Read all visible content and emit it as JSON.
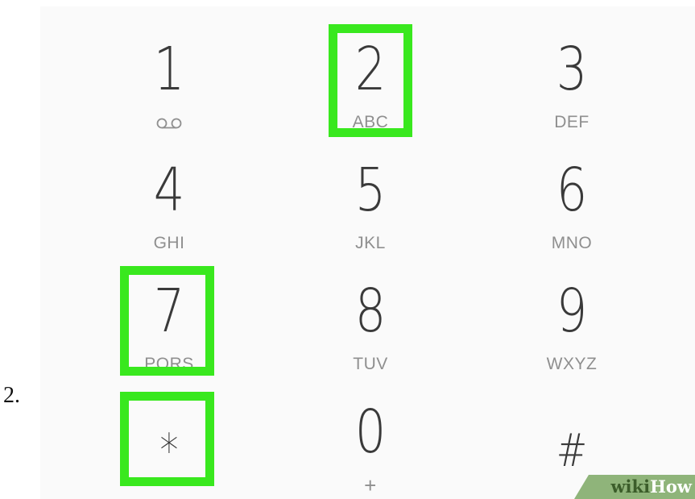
{
  "step_label": "2.",
  "keypad": {
    "keys": [
      {
        "digit": "1",
        "letters": "",
        "icon": "voicemail-icon"
      },
      {
        "digit": "2",
        "letters": "ABC"
      },
      {
        "digit": "3",
        "letters": "DEF"
      },
      {
        "digit": "4",
        "letters": "GHI"
      },
      {
        "digit": "5",
        "letters": "JKL"
      },
      {
        "digit": "6",
        "letters": "MNO"
      },
      {
        "digit": "7",
        "letters": "PQRS"
      },
      {
        "digit": "8",
        "letters": "TUV"
      },
      {
        "digit": "9",
        "letters": "WXYZ"
      },
      {
        "digit": "*",
        "letters": ""
      },
      {
        "digit": "0",
        "letters": "+"
      },
      {
        "digit": "#",
        "letters": ""
      }
    ],
    "highlighted_keys": [
      "2",
      "7",
      "*"
    ]
  },
  "colors": {
    "highlight": "#39e81e",
    "background": "#fafafa",
    "digit": "#3a3a3a",
    "letters": "#8f8f8f"
  },
  "watermark": {
    "part1": "wiki",
    "part2": "How"
  }
}
